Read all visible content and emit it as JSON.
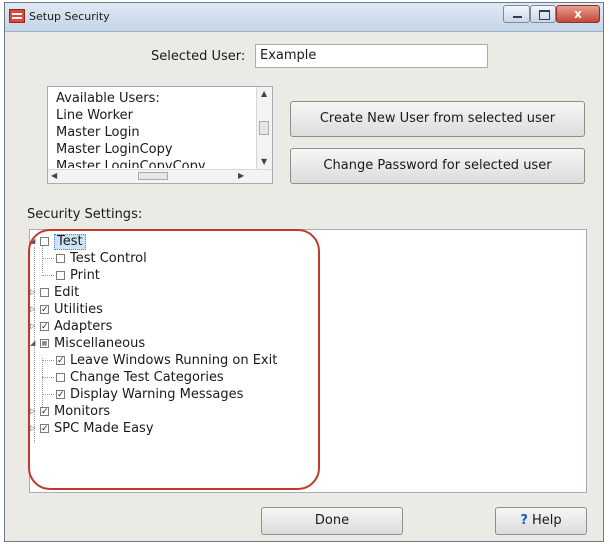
{
  "window": {
    "title": "Setup Security"
  },
  "caption_buttons": {
    "close_symbol": "x"
  },
  "selected_user": {
    "label": "Selected User:",
    "value": "Example"
  },
  "available_users": {
    "header": "Available Users:",
    "items": [
      "Line Worker",
      "Master Login",
      "Master LoginCopy",
      "Master LoginCopyCopy"
    ]
  },
  "buttons": {
    "create_user": "Create New User from selected user",
    "change_password": "Change Password for selected user",
    "done": "Done",
    "help": "Help",
    "help_icon": "?"
  },
  "security_settings": {
    "label": "Security Settings:",
    "tree": [
      {
        "label": "Test",
        "checked": false,
        "expanded": true,
        "level": 0,
        "selected": true
      },
      {
        "label": "Test Control",
        "checked": false,
        "level": 1
      },
      {
        "label": "Print",
        "checked": false,
        "level": 1
      },
      {
        "label": "Edit",
        "checked": false,
        "expanded": false,
        "level": 0
      },
      {
        "label": "Utilities",
        "checked": true,
        "expanded": false,
        "level": 0
      },
      {
        "label": "Adapters",
        "checked": true,
        "expanded": false,
        "level": 0
      },
      {
        "label": "Miscellaneous",
        "checked": "partial",
        "expanded": true,
        "level": 0
      },
      {
        "label": "Leave Windows Running on Exit",
        "checked": true,
        "level": 1
      },
      {
        "label": "Change Test Categories",
        "checked": false,
        "level": 1
      },
      {
        "label": "Display Warning Messages",
        "checked": true,
        "level": 1
      },
      {
        "label": "Monitors",
        "checked": true,
        "expanded": false,
        "level": 0
      },
      {
        "label": "SPC Made Easy",
        "checked": true,
        "expanded": false,
        "level": 0
      }
    ]
  },
  "glyphs": {
    "check": "✓",
    "partial": "■",
    "expand_closed": "▷",
    "expand_open": "◢"
  },
  "colors": {
    "highlight_oval": "#c0392b",
    "window_bg": "#eceae4",
    "help_icon": "#1f5fb5"
  }
}
